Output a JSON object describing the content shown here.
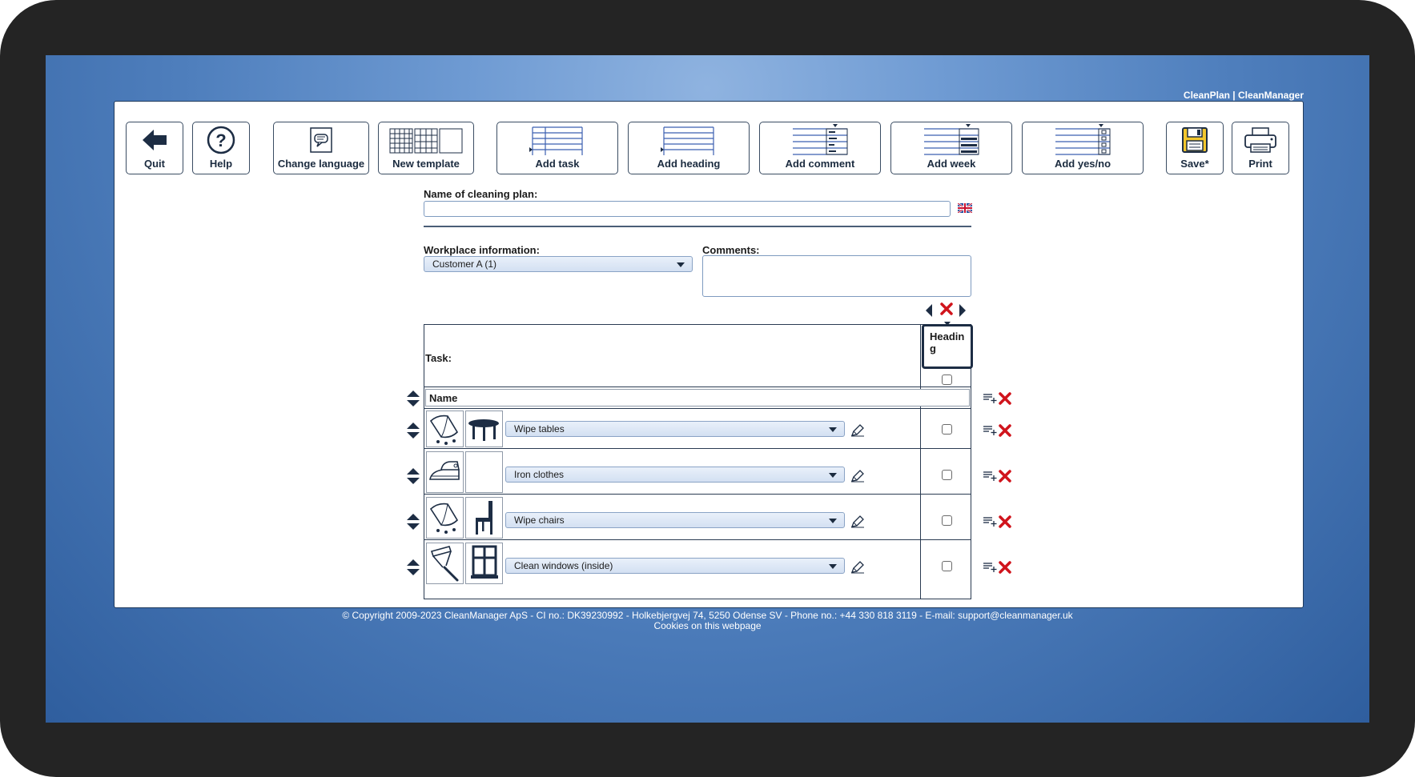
{
  "brand": "CleanPlan | CleanManager",
  "toolbar": {
    "quit": "Quit",
    "help": "Help",
    "change_language": "Change language",
    "new_template": "New template",
    "add_task": "Add task",
    "add_heading": "Add heading",
    "add_comment": "Add comment",
    "add_week": "Add week",
    "add_yesno": "Add yes/no",
    "save": "Save*",
    "print": "Print"
  },
  "form": {
    "name_label": "Name of cleaning plan:",
    "name_value": "",
    "workplace_label": "Workplace information:",
    "workplace_value": "Customer A (1)",
    "comments_label": "Comments:",
    "comments_value": ""
  },
  "table": {
    "task_label": "Task:",
    "column_heading": "Heading",
    "name_header": "Name",
    "rows": [
      {
        "task": "Wipe tables",
        "icons": [
          "cloth-icon",
          "table-icon"
        ]
      },
      {
        "task": "Iron clothes",
        "icons": [
          "iron-icon"
        ]
      },
      {
        "task": "Wipe chairs",
        "icons": [
          "cloth-icon",
          "chair-icon"
        ]
      },
      {
        "task": "Clean windows (inside)",
        "icons": [
          "squeegee-icon",
          "window-icon"
        ]
      }
    ]
  },
  "footer": {
    "copyright": "© Copyright 2009-2023 CleanManager ApS - CI no.: DK39230992 - Holkebjergvej 74, 5250 Odense SV - Phone no.: +44 330 818 3119 - E-mail: support@cleanmanager.uk",
    "cookies": "Cookies on this webpage"
  }
}
